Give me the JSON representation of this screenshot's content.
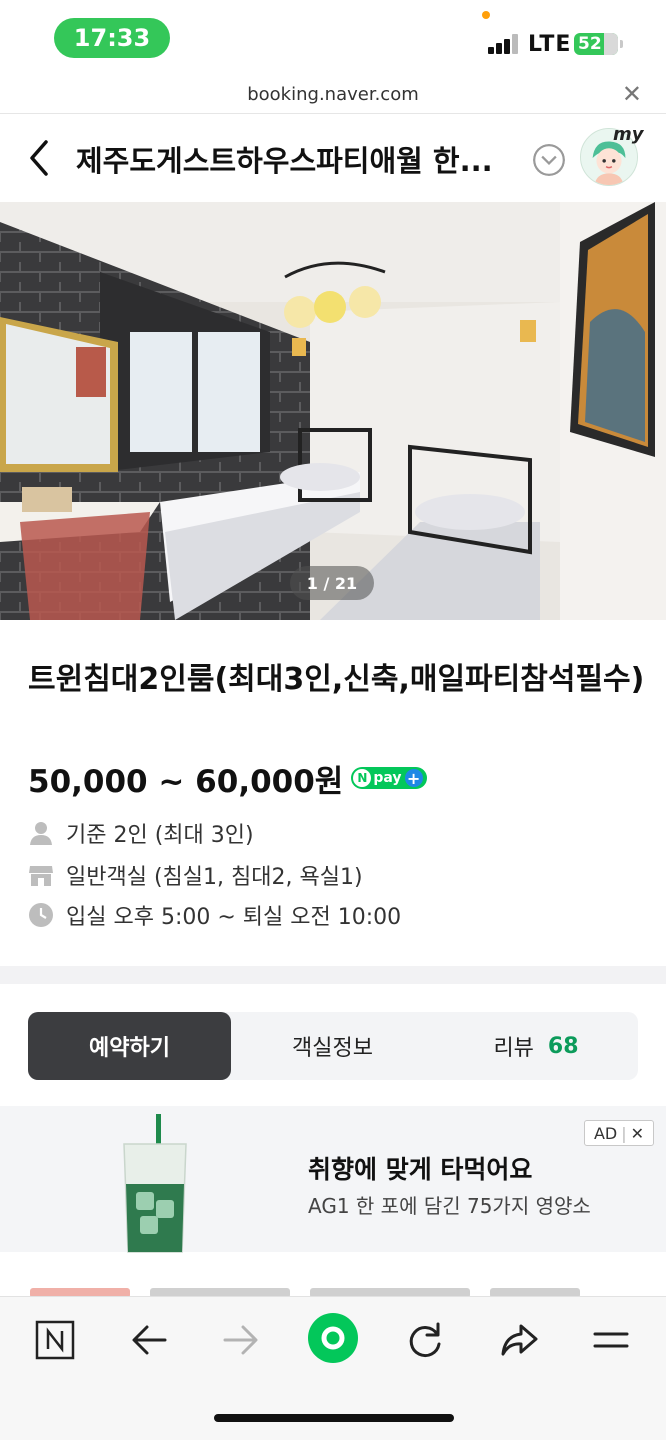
{
  "status_bar": {
    "time": "17:33",
    "network": "LTE",
    "battery": "52"
  },
  "url_bar": {
    "url": "booking.naver.com",
    "close_icon": "close-icon"
  },
  "header": {
    "title": "제주도게스트하우스파티애월 한...",
    "profile_label": "my"
  },
  "photo": {
    "counter": "1 / 21"
  },
  "room": {
    "title": "트윈침대2인룸(최대3인,신축,매일파티참석필수)",
    "price": "50,000 ~ 60,000원",
    "pay_badge": "pay",
    "pay_badge_n": "N",
    "pay_badge_plus": "+",
    "capacity": "기준 2인 (최대 3인)",
    "room_type": "일반객실 (침실1, 침대2, 욕실1)",
    "checkin": "입실 오후 5:00 ~ 퇴실 오전 10:00"
  },
  "tabs": {
    "reserve": "예약하기",
    "room_info": "객실정보",
    "review": "리뷰",
    "review_count": "68"
  },
  "ad": {
    "badge": "AD",
    "badge_close": "✕",
    "title": "취향에 맞게 타먹어요",
    "subtitle": "AG1 한 포에 담긴 75가지 영양소"
  },
  "colors": {
    "naver_green": "#03c75a",
    "status_green": "#34c759",
    "tab_active": "#3c3d40",
    "review_green": "#0c9b5b"
  },
  "toolbar": {
    "icons": [
      "naver-n-icon",
      "back-arrow-icon",
      "forward-arrow-icon",
      "home-circle-icon",
      "refresh-icon",
      "share-icon",
      "menu-icon"
    ]
  }
}
